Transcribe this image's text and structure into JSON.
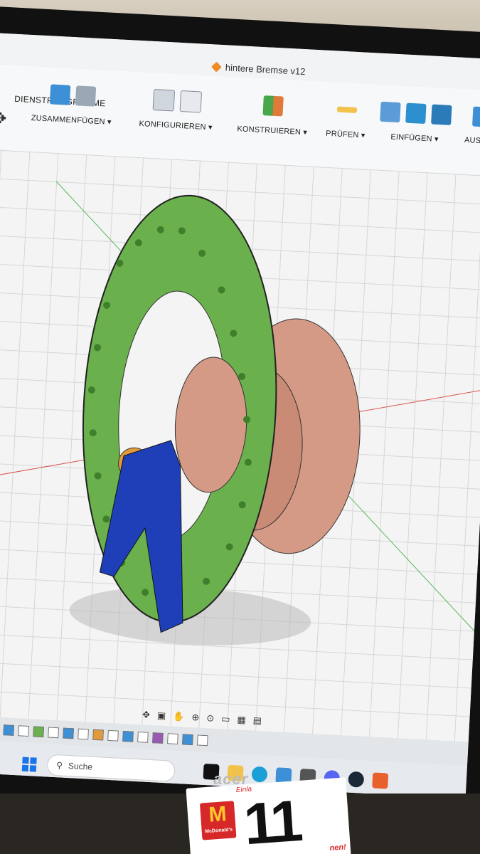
{
  "app": {
    "document_title": "hintere Bremse v12"
  },
  "toolbar": {
    "section_label": "DIENSTPROGRAMME",
    "groups": [
      {
        "label": "ZUSAMMENFÜGEN ▾"
      },
      {
        "label": "KONFIGURIEREN ▾"
      },
      {
        "label": "KONSTRUIEREN ▾"
      },
      {
        "label": "PRÜFEN ▾"
      },
      {
        "label": "EINFÜGEN ▾"
      },
      {
        "label": "AUSW"
      }
    ]
  },
  "taskbar": {
    "search_label": "Suche"
  },
  "monitor": {
    "brand": "acer"
  },
  "table_card": {
    "number": "11",
    "top_text": "Einla",
    "bottom_text": "nen!",
    "logo_text": "McDonald's"
  },
  "colors": {
    "disc": "#6ab04c",
    "hub": "#d49a86",
    "caliper": "#1f3fb8",
    "bushing": "#e39a3c",
    "accent": "#f08a24"
  }
}
